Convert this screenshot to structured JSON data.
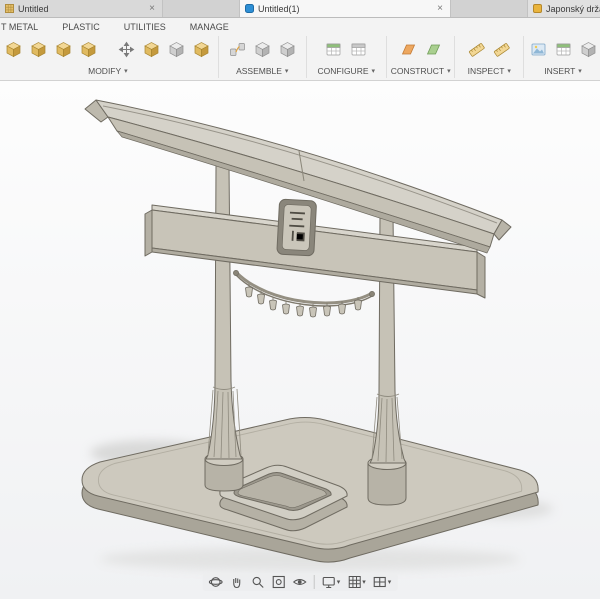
{
  "window": {
    "tabs": [
      {
        "icon": "tan-grid-doc-icon",
        "label": "Untitled",
        "close": "×"
      },
      {
        "icon": "blue-doc-icon",
        "label": "Untitled(1)",
        "close": "×"
      },
      {
        "icon": "yellow-doc-icon",
        "label": "Japonský držá"
      }
    ]
  },
  "ribbon": {
    "menu_tabs": [
      "T METAL",
      "PLASTIC",
      "UTILITIES",
      "MANAGE"
    ],
    "caret": "▾",
    "groups": [
      {
        "label": "MODIFY",
        "icons": [
          "yellow-cube-tool",
          "yellow-cube-tool",
          "yellow-cube-tool",
          "yellow-cube-tool",
          "move-arrows",
          "yellow-cube-tool",
          "gray-cube-tool",
          "yellow-cube-tool"
        ]
      },
      {
        "label": "ASSEMBLE",
        "icons": [
          "joint",
          "gray-cube-tool",
          "gray-cube-tool"
        ]
      },
      {
        "label": "CONFIGURE",
        "icons": [
          "table-green-header",
          "table-plain"
        ]
      },
      {
        "label": "CONSTRUCT",
        "icons": [
          "plane-orange",
          "plane-green"
        ]
      },
      {
        "label": "INSPECT",
        "icons": [
          "measure-ruler",
          "measure-ruler"
        ]
      },
      {
        "label": "INSERT",
        "icons": [
          "picture-canvas",
          "table-green-header",
          "gray-cube-tool"
        ]
      }
    ]
  },
  "viewport": {
    "content": "3D model of a Japanese torii gate with rope and tassels, standing on a rounded base plate with a recessed tray"
  },
  "navbar": {
    "icons": [
      "orbit",
      "pan-hand",
      "zoom-magnifier",
      "fit-to-view",
      "look-at-eye",
      "display-settings",
      "grid-and-snaps",
      "viewports"
    ],
    "caret": "▾"
  },
  "colors": {
    "canvas_top": "#fdfdfd",
    "canvas_bottom": "#f0f1f3",
    "model_light": "#d5d2c9",
    "model_mid": "#c6c2b6",
    "model_dark": "#aeaa9e",
    "outline": "#6f6b61",
    "icon_yellow": "#f2d795",
    "tab_active_bg": "#f7f7f7"
  }
}
